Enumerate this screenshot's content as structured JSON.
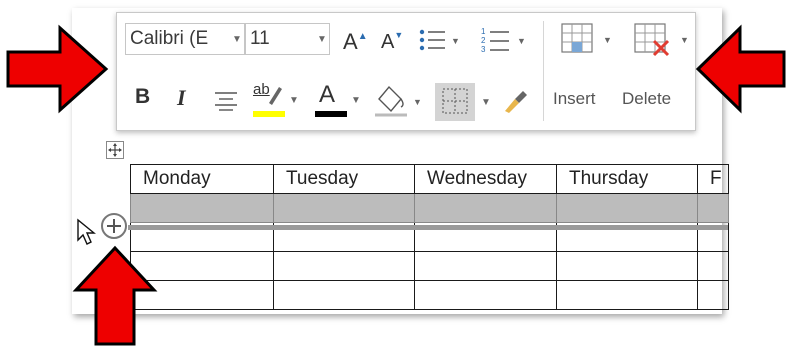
{
  "toolbar": {
    "font_name": "Calibri (E",
    "font_size": "11",
    "grow_font_glyph": "A",
    "shrink_font_glyph": "A",
    "bold_glyph": "B",
    "italic_glyph": "I",
    "highlight_glyph": "ab",
    "font_color_glyph": "A",
    "insert_label": "Insert",
    "delete_label": "Delete",
    "highlight_color": "#ffff00",
    "font_color": "#000000"
  },
  "table": {
    "headers": [
      "Monday",
      "Tuesday",
      "Wednesday",
      "Thursday",
      "F"
    ]
  },
  "annotations": {
    "arrow_color": "#ee0000"
  },
  "icons": [
    "move-table-icon",
    "insert-row-plus-icon",
    "pointer-cursor-icon",
    "format-painter-icon",
    "bullets-icon",
    "numbering-icon",
    "shading-icon",
    "borders-icon",
    "insert-table-icon",
    "delete-table-icon"
  ]
}
